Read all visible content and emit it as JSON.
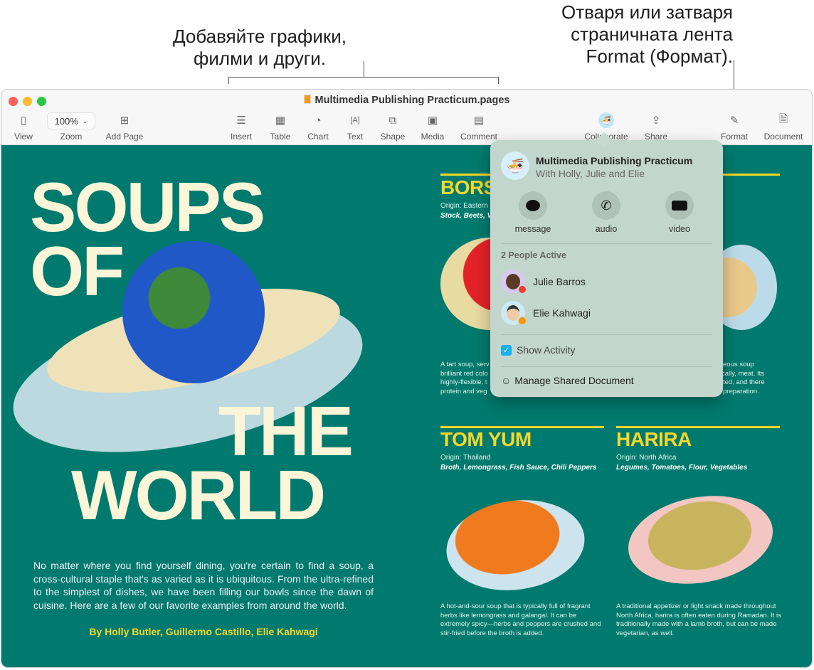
{
  "callouts": {
    "left_line1": "Добавяйте графики,",
    "left_line2": "филми и други.",
    "right_line1": "Отваря или затваря",
    "right_line2": "страничната лента",
    "right_line3": "Format (Формат)."
  },
  "window": {
    "title": "Multimedia Publishing Practicum.pages"
  },
  "toolbar": {
    "view": "View",
    "zoom_value": "100%",
    "zoom": "Zoom",
    "add_page": "Add Page",
    "insert": "Insert",
    "table": "Table",
    "chart": "Chart",
    "text": "Text",
    "shape": "Shape",
    "media": "Media",
    "comment": "Comment",
    "collaborate": "Collaborate",
    "share": "Share",
    "format": "Format",
    "document": "Document"
  },
  "document": {
    "title_words": [
      "SOUPS",
      "OF",
      "THE",
      "WORLD"
    ],
    "intro": "No matter where you find yourself dining, you're certain to find a soup, a cross-cultural staple that's as varied as it is ubiquitous. From the ultra-refined to the simplest of dishes, we have been filling our bowls since the dawn of cuisine. Here are a few of our favorite examples from around the world.",
    "byline": "By Holly Butler, Guillermo Castillo, Elie Kahwagi",
    "borscht": {
      "title": "BORS",
      "origin": "Origin: Eastern",
      "ingredients": "Stock, Beets, Ve",
      "desc": [
        "A tart soup, serv",
        "brilliant red colo",
        "highly-flexible, t",
        "protein and veg"
      ]
    },
    "hidden_right": {
      "ingredients": "t",
      "desc": [
        "eous soup",
        "cally, meat. Its",
        "ted, and there",
        "preparation."
      ]
    },
    "tomyum": {
      "title": "TOM YUM",
      "origin": "Origin: Thailand",
      "ingredients": "Broth, Lemongrass, Fish Sauce, Chili Peppers",
      "desc": "A hot-and-sour soup that is typically full of fragrant herbs like lemongrass and galangal. It can be extremely spicy—herbs and peppers are crushed and stir-fried before the broth is added."
    },
    "harira": {
      "title": "HARIRA",
      "origin": "Origin: North Africa",
      "ingredients": "Legumes, Tomatoes, Flour, Vegetables",
      "desc": "A traditional appetizer or light snack made throughout North Africa, harira is often eaten during Ramadan. It is traditionally made with a lamb broth, but can be made vegetarian, as well."
    }
  },
  "popover": {
    "doc_title": "Multimedia Publishing Practicum",
    "with": "With Holly, Julie and Elie",
    "message": "message",
    "audio": "audio",
    "video": "video",
    "active_heading": "2 People Active",
    "people": [
      {
        "name": "Julie Barros",
        "status_color": "#f23c32"
      },
      {
        "name": "Elie Kahwagi",
        "status_color": "#ff9500"
      }
    ],
    "show_activity": "Show Activity",
    "show_activity_checked": true,
    "manage": "Manage Shared Document"
  },
  "colors": {
    "page_bg": "#007a6e",
    "accent_yellow": "#f5d72a",
    "title_cream": "#fbf6d8",
    "checkbox": "#1ab0f0"
  }
}
